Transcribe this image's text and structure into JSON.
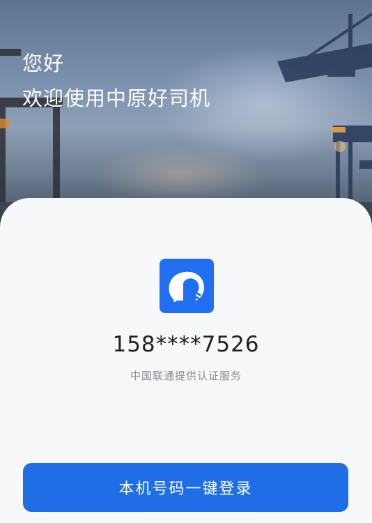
{
  "hero": {
    "greeting_line1": "您好",
    "greeting_line2": "欢迎使用中原好司机"
  },
  "card": {
    "app_icon": "elephant-logo-icon",
    "phone_number": "158****7526",
    "provider_text": "中国联通提供认证服务",
    "login_button_label": "本机号码一键登录"
  },
  "colors": {
    "brand_blue": "#1e6ee8",
    "logo_blue": "#1f6ff0",
    "card_bg": "#f7f8fa",
    "secondary_text": "#8a8d93"
  }
}
